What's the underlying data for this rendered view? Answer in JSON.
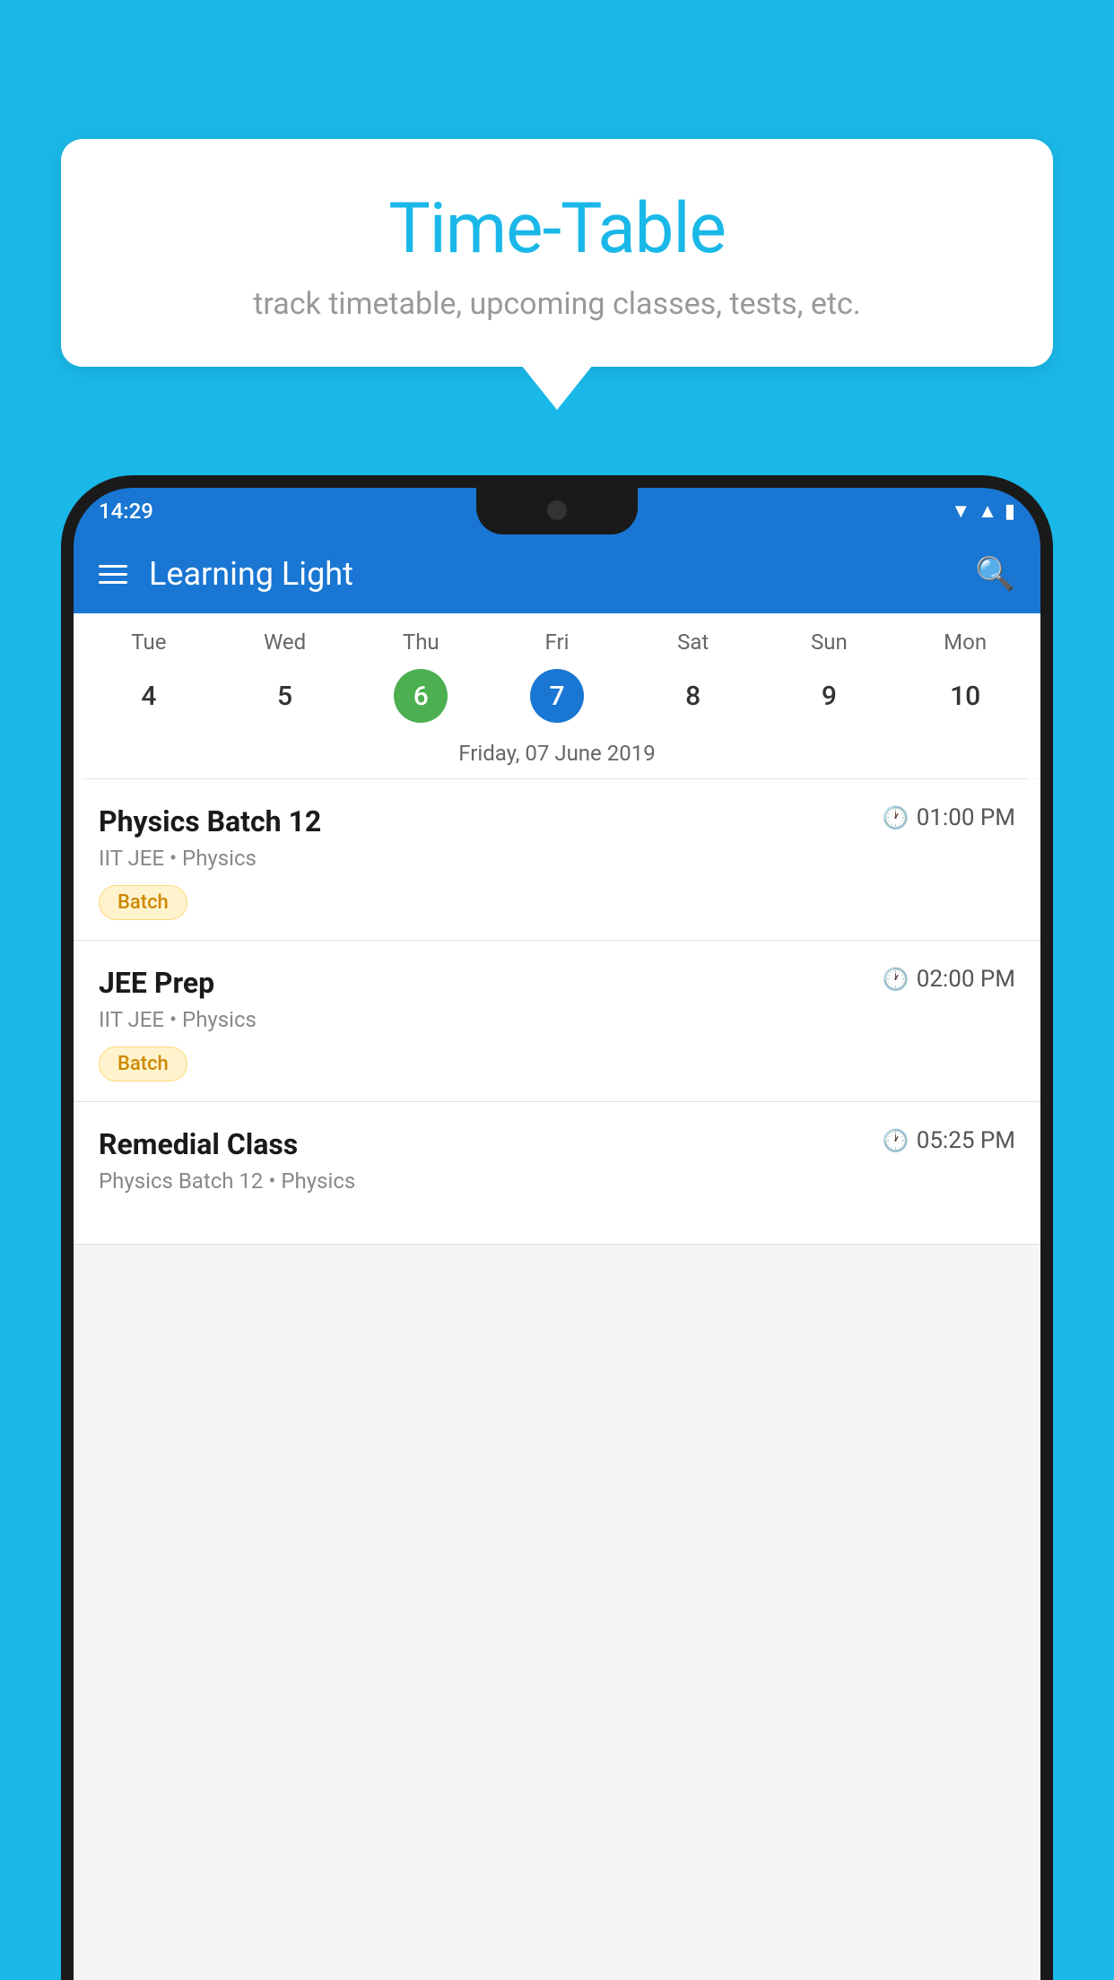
{
  "background_color": "#1ab8e8",
  "speech_bubble": {
    "title": "Time-Table",
    "subtitle": "track timetable, upcoming classes, tests, etc."
  },
  "phone": {
    "status_bar": {
      "time": "14:29"
    },
    "app_bar": {
      "title": "Learning Light"
    },
    "calendar": {
      "days": [
        "Tue",
        "Wed",
        "Thu",
        "Fri",
        "Sat",
        "Sun",
        "Mon"
      ],
      "dates": [
        "4",
        "5",
        "6",
        "7",
        "8",
        "9",
        "10"
      ],
      "today_index": 2,
      "selected_index": 3,
      "selected_date_label": "Friday, 07 June 2019"
    },
    "schedule": [
      {
        "title": "Physics Batch 12",
        "time": "01:00 PM",
        "subtitle": "IIT JEE • Physics",
        "tag": "Batch"
      },
      {
        "title": "JEE Prep",
        "time": "02:00 PM",
        "subtitle": "IIT JEE • Physics",
        "tag": "Batch"
      },
      {
        "title": "Remedial Class",
        "time": "05:25 PM",
        "subtitle": "Physics Batch 12 • Physics",
        "tag": null
      }
    ]
  }
}
